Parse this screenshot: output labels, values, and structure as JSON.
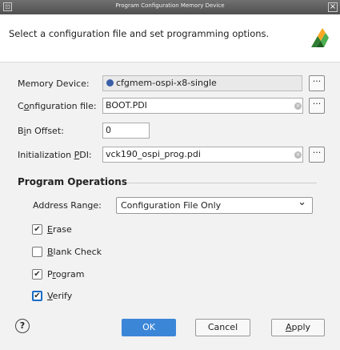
{
  "window": {
    "title": "Program Configuration Memory Device"
  },
  "header": {
    "description": "Select a configuration file and set programming options."
  },
  "form": {
    "memory_device": {
      "label": "Memory Device:",
      "value": "cfgmem-ospi-x8-single"
    },
    "config_file": {
      "label_pre": "C",
      "label_u": "o",
      "label_post": "nfiguration file:",
      "value": "BOOT.PDI"
    },
    "bin_offset": {
      "label_pre": "B",
      "label_u": "i",
      "label_post": "n Offset:",
      "value": "0"
    },
    "init_pdi": {
      "label_pre": "Initialization ",
      "label_u": "P",
      "label_post": "DI:",
      "value": "vck190_ospi_prog.pdi"
    },
    "browse": "···"
  },
  "operations": {
    "title": "Program Operations",
    "address_range": {
      "label_pre": "Address Ran",
      "label_u": "g",
      "label_post": "e:",
      "value": "Configuration File Only"
    },
    "erase": {
      "u": "E",
      "rest": "rase",
      "checked": true
    },
    "blank_check": {
      "u": "B",
      "rest": "lank Check",
      "checked": false
    },
    "program": {
      "pre": "P",
      "u": "r",
      "rest": "ogram",
      "checked": true
    },
    "verify": {
      "u": "V",
      "rest": "erify",
      "checked": true
    }
  },
  "buttons": {
    "help": "?",
    "ok": "OK",
    "cancel": "Cancel",
    "apply_u": "A",
    "apply_rest": "pply"
  },
  "icons": {
    "check": "✔",
    "chevron": "⌄",
    "clear": "×",
    "close": "×"
  }
}
